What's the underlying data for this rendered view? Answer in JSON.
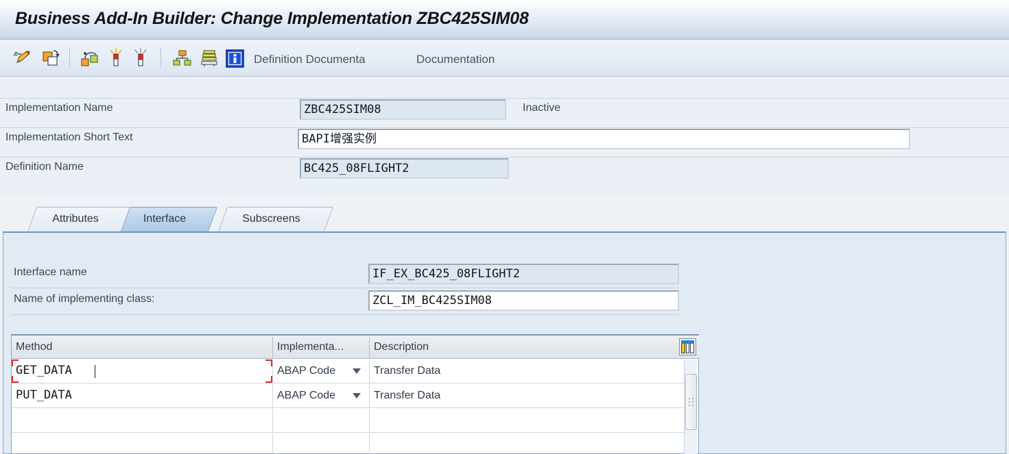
{
  "window": {
    "title": "Business Add-In Builder: Change Implementation ZBC425SIM08"
  },
  "toolbar": {
    "icons": [
      {
        "name": "display-change-icon",
        "title": "Display <-> Change"
      },
      {
        "name": "copy-implementation-icon",
        "title": "Copy Implementation"
      },
      {
        "name": "activate-icon",
        "title": "Activate"
      },
      {
        "name": "deactivate-icon",
        "title": "Deactivate"
      },
      {
        "name": "interface-hierarchy-icon",
        "title": "Interface"
      },
      {
        "name": "display-object-list-icon",
        "title": "Object List"
      },
      {
        "name": "information-icon",
        "title": "Information"
      }
    ],
    "definition_documentation_label": "Definition Documenta",
    "documentation_label": "Documentation"
  },
  "header_form": {
    "implementation_name_label": "Implementation Name",
    "implementation_name_value": "ZBC425SIM08",
    "status": "Inactive",
    "short_text_label": "Implementation Short Text",
    "short_text_value": "BAPI增强实例",
    "definition_name_label": "Definition Name",
    "definition_name_value": "BC425_08FLIGHT2"
  },
  "tabs": [
    {
      "label": "Attributes",
      "active": false
    },
    {
      "label": "Interface",
      "active": true
    },
    {
      "label": "Subscreens",
      "active": false
    }
  ],
  "interface_panel": {
    "interface_name_label": "Interface name",
    "interface_name_value": "IF_EX_BC425_08FLIGHT2",
    "implementing_class_label": "Name of implementing class:",
    "implementing_class_value": "ZCL_IM_BC425SIM08"
  },
  "method_table": {
    "columns": [
      "Method",
      "Implementa...",
      "Description"
    ],
    "rows": [
      {
        "method": "GET_DATA",
        "implementation": "ABAP Code",
        "description": "Transfer Data",
        "selected": true
      },
      {
        "method": "PUT_DATA",
        "implementation": "ABAP Code",
        "description": "Transfer Data",
        "selected": false
      },
      {
        "method": "",
        "implementation": "",
        "description": "",
        "selected": false
      }
    ],
    "settings_icon": "table-settings-icon"
  },
  "colors": {
    "title_text": "#111418",
    "form_background": "#eaf0f6",
    "field_readonly": "#dde7f1",
    "field_editable": "#ffffff",
    "tab_active": "#aec9e6",
    "selection_marker": "#e02b2b"
  }
}
